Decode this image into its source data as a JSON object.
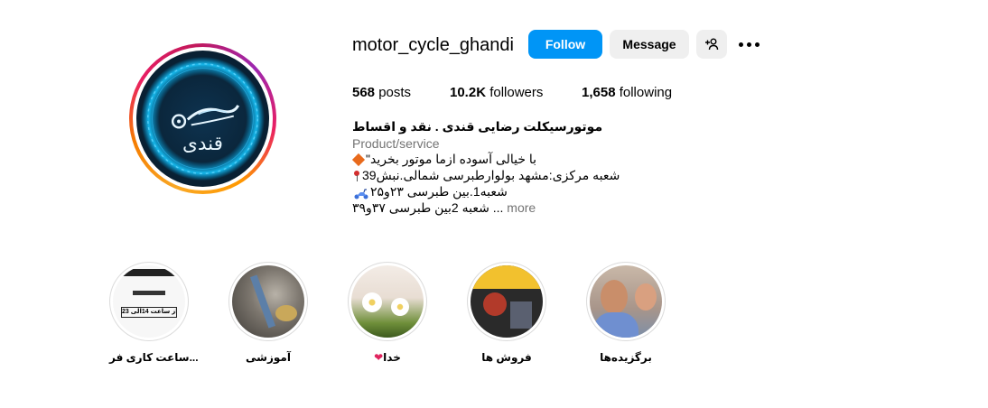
{
  "profile": {
    "username": "motor_cycle_ghandi",
    "avatar_alt": "قندی"
  },
  "actions": {
    "follow_label": "Follow",
    "message_label": "Message",
    "add_user_icon": "add-user-icon",
    "more_icon": "more-options-icon"
  },
  "stats": {
    "posts_count": "568",
    "posts_label": "posts",
    "followers_count": "10.2K",
    "followers_label": "followers",
    "following_count": "1,658",
    "following_label": "following"
  },
  "bio": {
    "name": "موتورسیکلت رضایی قندی . نقد و اقساط",
    "category": "Product/service",
    "line1": "\"با خیالی آسوده ازما موتور بخرید",
    "line2": "شعبه مرکزی:مشهد بولوارطبرسی شمالی.نبش39",
    "line3": "شعبه1.بین طبرسی ۲۳و۲۵",
    "line4": "شعبه 2بین طبرسی ۳۷و۳۹ ...",
    "more": "more"
  },
  "highlights": [
    {
      "label": "ساعت کاری فر...",
      "inner_text": "از ساعت 14الی 23"
    },
    {
      "label": "آموزشی"
    },
    {
      "label": "خدا"
    },
    {
      "label": "فروش ها"
    },
    {
      "label": "برگزیده‌ها"
    }
  ],
  "colors": {
    "follow_bg": "#0095f6",
    "secondary_bg": "#efefef",
    "muted_text": "#737373"
  }
}
